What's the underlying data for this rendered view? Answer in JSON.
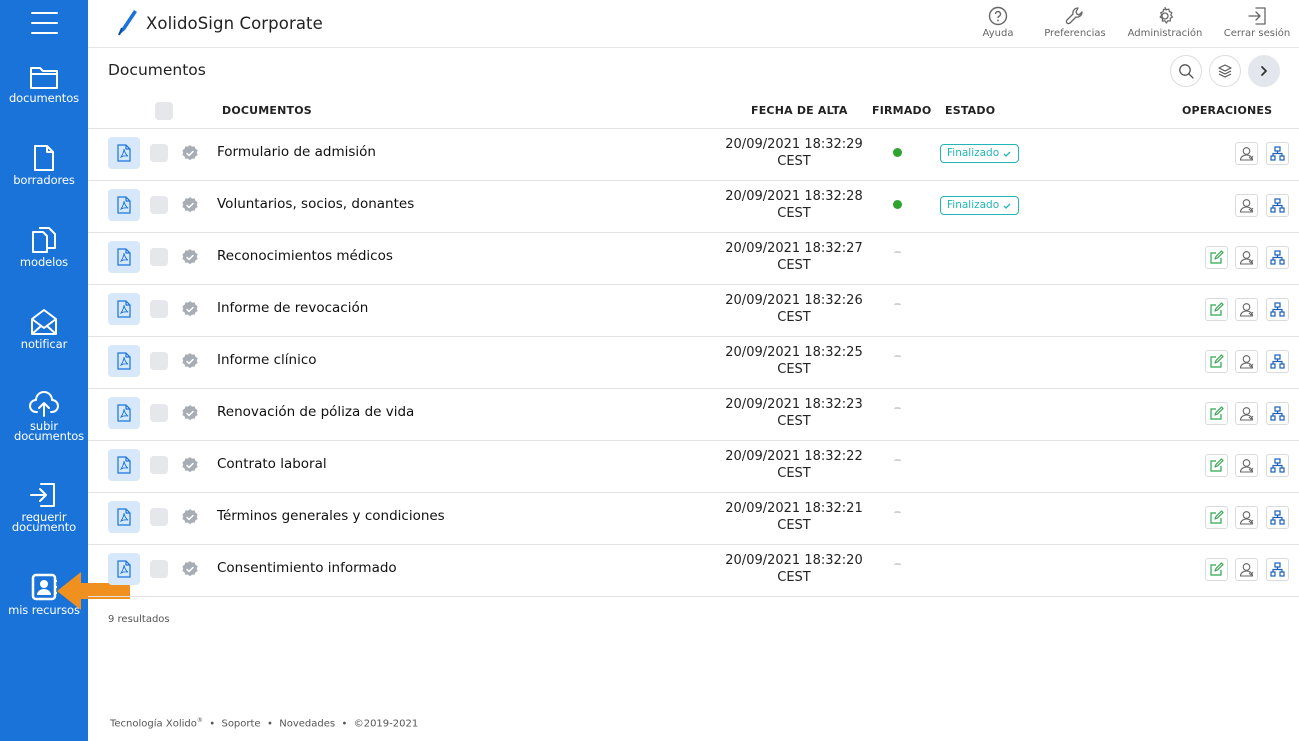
{
  "app": {
    "name": "XolidoSign Corporate"
  },
  "sidebar": {
    "items": [
      {
        "label": "documentos",
        "icon": "folder-icon"
      },
      {
        "label": "borradores",
        "icon": "draft-file-icon"
      },
      {
        "label": "modelos",
        "icon": "copy-files-icon"
      },
      {
        "label": "notificar",
        "icon": "envelope-icon"
      },
      {
        "label": "subir documentos",
        "icon": "cloud-upload-icon"
      },
      {
        "label": "requerir documento",
        "icon": "sign-in-icon"
      },
      {
        "label": "mis recursos",
        "icon": "contact-book-icon"
      }
    ]
  },
  "header": {
    "actions": [
      {
        "label": "Ayuda",
        "icon": "help-icon"
      },
      {
        "label": "Preferencias",
        "icon": "wrench-icon"
      },
      {
        "label": "Administración",
        "icon": "gear-icon"
      },
      {
        "label": "Cerrar sesión",
        "icon": "logout-icon"
      }
    ]
  },
  "page": {
    "title": "Documentos"
  },
  "table": {
    "columns": {
      "documents": "DOCUMENTOS",
      "date": "FECHA DE ALTA",
      "signed": "FIRMADO",
      "status": "ESTADO",
      "operations": "OPERACIONES"
    },
    "rows": [
      {
        "name": "Formulario de admisión",
        "date": "20/09/2021 18:32:29",
        "tz": "CEST",
        "signed": true,
        "status": "Finalizado",
        "editable": false
      },
      {
        "name": "Voluntarios, socios, donantes",
        "date": "20/09/2021 18:32:28",
        "tz": "CEST",
        "signed": true,
        "status": "Finalizado",
        "editable": false
      },
      {
        "name": "Reconocimientos médicos",
        "date": "20/09/2021 18:32:27",
        "tz": "CEST",
        "signed": false,
        "status": "",
        "editable": true
      },
      {
        "name": "Informe de revocación",
        "date": "20/09/2021 18:32:26",
        "tz": "CEST",
        "signed": false,
        "status": "",
        "editable": true
      },
      {
        "name": "Informe clínico",
        "date": "20/09/2021 18:32:25",
        "tz": "CEST",
        "signed": false,
        "status": "",
        "editable": true
      },
      {
        "name": "Renovación de póliza de vida",
        "date": "20/09/2021 18:32:23",
        "tz": "CEST",
        "signed": false,
        "status": "",
        "editable": true
      },
      {
        "name": "Contrato laboral",
        "date": "20/09/2021 18:32:22",
        "tz": "CEST",
        "signed": false,
        "status": "",
        "editable": true
      },
      {
        "name": "Términos generales y condiciones",
        "date": "20/09/2021 18:32:21",
        "tz": "CEST",
        "signed": false,
        "status": "",
        "editable": true
      },
      {
        "name": "Consentimiento informado",
        "date": "20/09/2021 18:32:20",
        "tz": "CEST",
        "signed": false,
        "status": "",
        "editable": true
      }
    ]
  },
  "results": "9 resultados",
  "footer": {
    "brand": "Tecnología Xolido",
    "reg": "®",
    "sep": "•",
    "support": "Soporte",
    "news": "Novedades",
    "copyright": "©2019-2021"
  },
  "colors": {
    "sidebar": "#1a73d9",
    "accent": "#1a73d9",
    "signed_dot": "#2ea32e",
    "badge": "#22b5b5",
    "edit": "#2fa84f",
    "arrow": "#f0901e"
  }
}
